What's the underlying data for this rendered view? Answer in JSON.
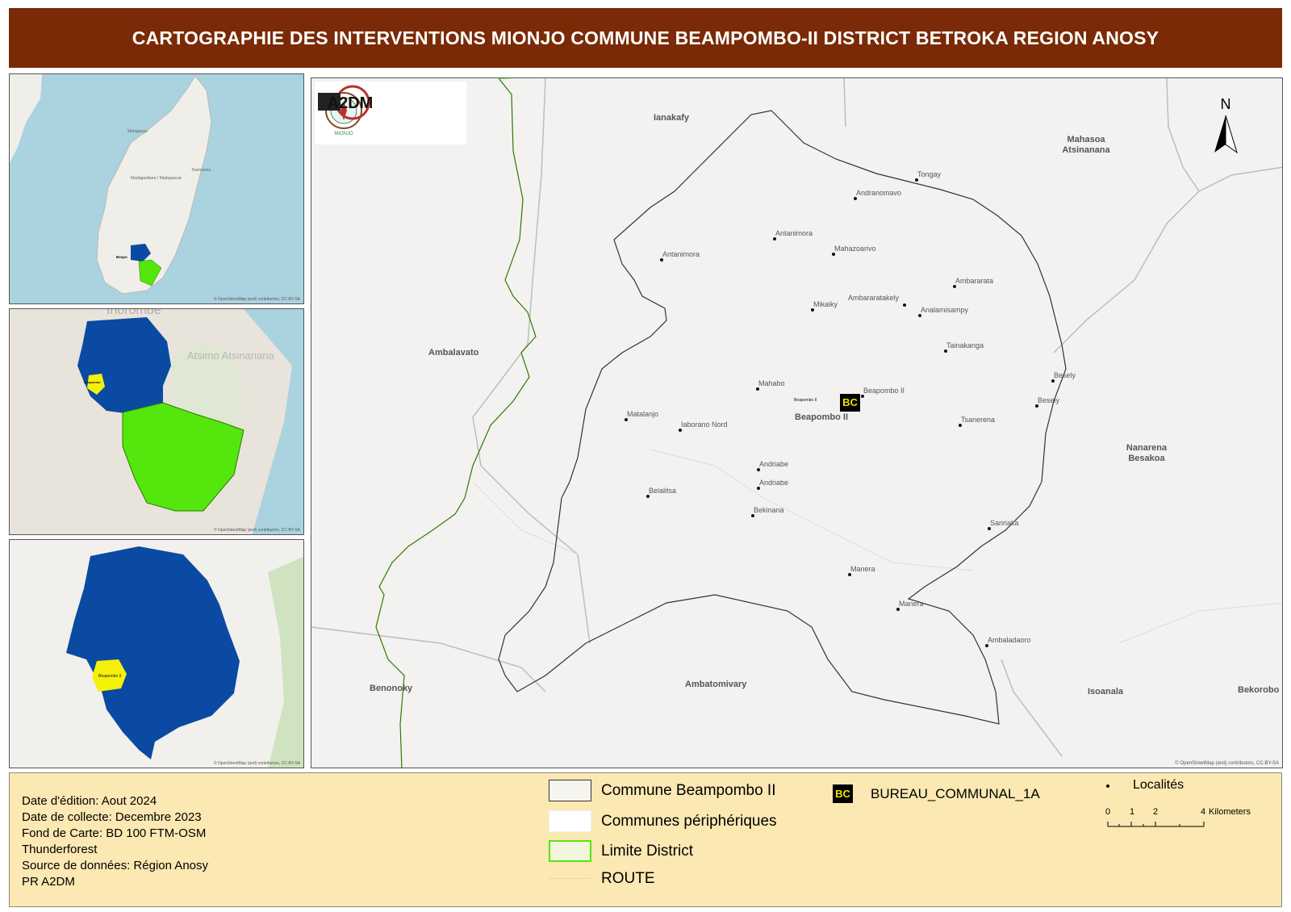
{
  "title": "CARTOGRAPHIE DES INTERVENTIONS MIONJO COMMUNE BEAMPOMBO-II  DISTRICT BETROKA REGION ANOSY",
  "colors": {
    "header_bg": "#7a2a06",
    "region_blue": "#0b4aa2",
    "district_green": "#55e60e",
    "commune_yellow": "#f5f00a",
    "sea": "#aad3df",
    "legend_bg": "#fce8b2",
    "bc_black": "#000000",
    "bc_yellow": "#f0e000"
  },
  "insets": {
    "credit": "© OpenStreetMap (and) contributors, CC-BY-SA",
    "inset1_labels": [
      {
        "text": "Mahajanga"
      },
      {
        "text": "Madagasikara / Madagascar"
      },
      {
        "text": "Toamasina"
      },
      {
        "text": "Beapo"
      }
    ],
    "inset2_labels": [
      {
        "text": "Ihorombe"
      },
      {
        "text": "Beapombo"
      },
      {
        "text": "Atsimo Atsinanana"
      }
    ],
    "inset3_labels": [
      {
        "text": "Beapombo II"
      }
    ]
  },
  "main_map": {
    "credit": "© OpenStreetMap (and) contributors, CC-BY-SA",
    "north_letter": "N",
    "logos": {
      "mionjo": "MIONJO",
      "a2dm": "A2DM"
    },
    "communes": [
      {
        "name": "Ianakafy"
      },
      {
        "name": "Mahasoa Atsinanana"
      },
      {
        "name": "Ambalavato"
      },
      {
        "name": "Nanarena Besakoa"
      },
      {
        "name": "Benonoky"
      },
      {
        "name": "Ambatomivary"
      },
      {
        "name": "Isoanala"
      },
      {
        "name": "Bekorobo"
      },
      {
        "name": "Beapombo II"
      }
    ],
    "localities": [
      {
        "name": "Tongay"
      },
      {
        "name": "Andranomavo"
      },
      {
        "name": "Antanimora"
      },
      {
        "name": "Mahazoarivo"
      },
      {
        "name": "Antanimora"
      },
      {
        "name": "Ambararata"
      },
      {
        "name": "Mikaiky"
      },
      {
        "name": "Ambararatakely"
      },
      {
        "name": "Analamisampy"
      },
      {
        "name": "Tainakanga"
      },
      {
        "name": "Besely"
      },
      {
        "name": "Besely"
      },
      {
        "name": "Mahabo"
      },
      {
        "name": "Beapombo II"
      },
      {
        "name": "Matalanjo"
      },
      {
        "name": "Iaborano Nord"
      },
      {
        "name": "Tsanerena"
      },
      {
        "name": "Andriabe"
      },
      {
        "name": "Andriabe"
      },
      {
        "name": "Belalitsa"
      },
      {
        "name": "Bekinana"
      },
      {
        "name": "Saririaka"
      },
      {
        "name": "Manera"
      },
      {
        "name": "Manera"
      },
      {
        "name": "Ambaladaoro"
      }
    ],
    "bureau_label": "Beapombo II",
    "bc_icon": "BC"
  },
  "legend": {
    "meta": [
      "Date d'édition: Aout 2024",
      "Date de collecte: Decembre 2023",
      "Fond de Carte: BD 100 FTM-OSM",
      "Thunderforest",
      "Source de données: Région Anosy",
      "PR A2DM"
    ],
    "items": [
      {
        "label": "Commune Beampombo II"
      },
      {
        "label": "Communes périphériques"
      },
      {
        "label": "Limite District"
      },
      {
        "label": "ROUTE"
      }
    ],
    "bureau": "BUREAU_COMMUNAL_1A",
    "bc_icon": "BC",
    "localites": "Localités",
    "scale": {
      "ticks": [
        "0",
        "1",
        "2",
        "4"
      ],
      "unit": "Kilometers"
    }
  }
}
